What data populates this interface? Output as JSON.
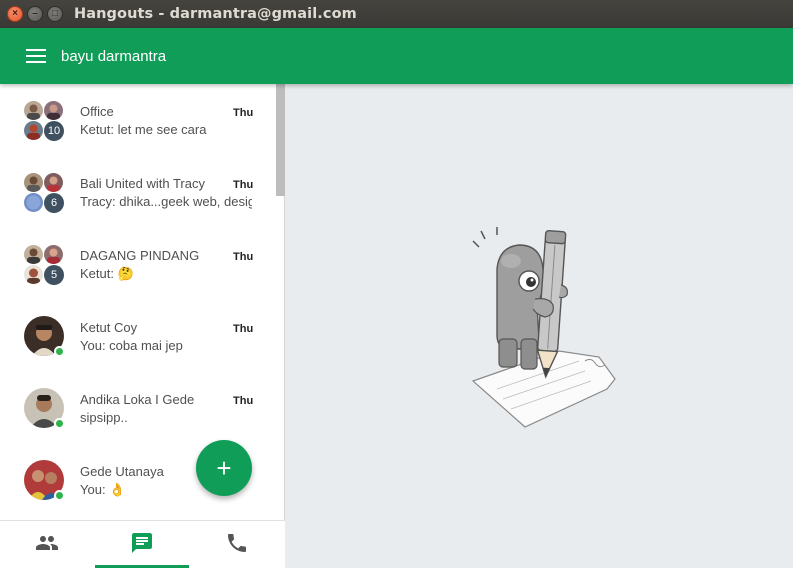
{
  "window": {
    "title": "Hangouts - darmantra@gmail.com",
    "close_glyph": "×",
    "min_glyph": "–",
    "max_glyph": "□"
  },
  "header": {
    "user_name": "bayu darmantra"
  },
  "conversations": [
    {
      "name": "Office",
      "message": "Ketut: let me see cara",
      "time": "Thu",
      "count": "10",
      "type": "group"
    },
    {
      "name": "Bali United with Tracy",
      "message": "Tracy: dhika...geek web, design",
      "time": "Thu",
      "count": "6",
      "type": "group"
    },
    {
      "name": "DAGANG PINDANG",
      "message": "Ketut: 🤔",
      "time": "Thu",
      "count": "5",
      "type": "group"
    },
    {
      "name": "Ketut Coy",
      "message": "You: coba mai jep",
      "time": "Thu",
      "type": "single"
    },
    {
      "name": "Andika Loka I Gede",
      "message": "sipsipp..",
      "time": "Thu",
      "type": "single"
    },
    {
      "name": "Gede Utanaya",
      "message": "You: 👌",
      "time": "",
      "type": "single"
    }
  ],
  "fab": {
    "glyph": "+"
  },
  "bottom_nav": {
    "tabs": [
      {
        "icon": "contacts-icon",
        "active": false
      },
      {
        "icon": "chat-icon",
        "active": true
      },
      {
        "icon": "phone-icon",
        "active": false
      }
    ]
  },
  "colors": {
    "accent": "#0f9d58",
    "online": "#2fb34b",
    "badge": "#3f5160"
  }
}
